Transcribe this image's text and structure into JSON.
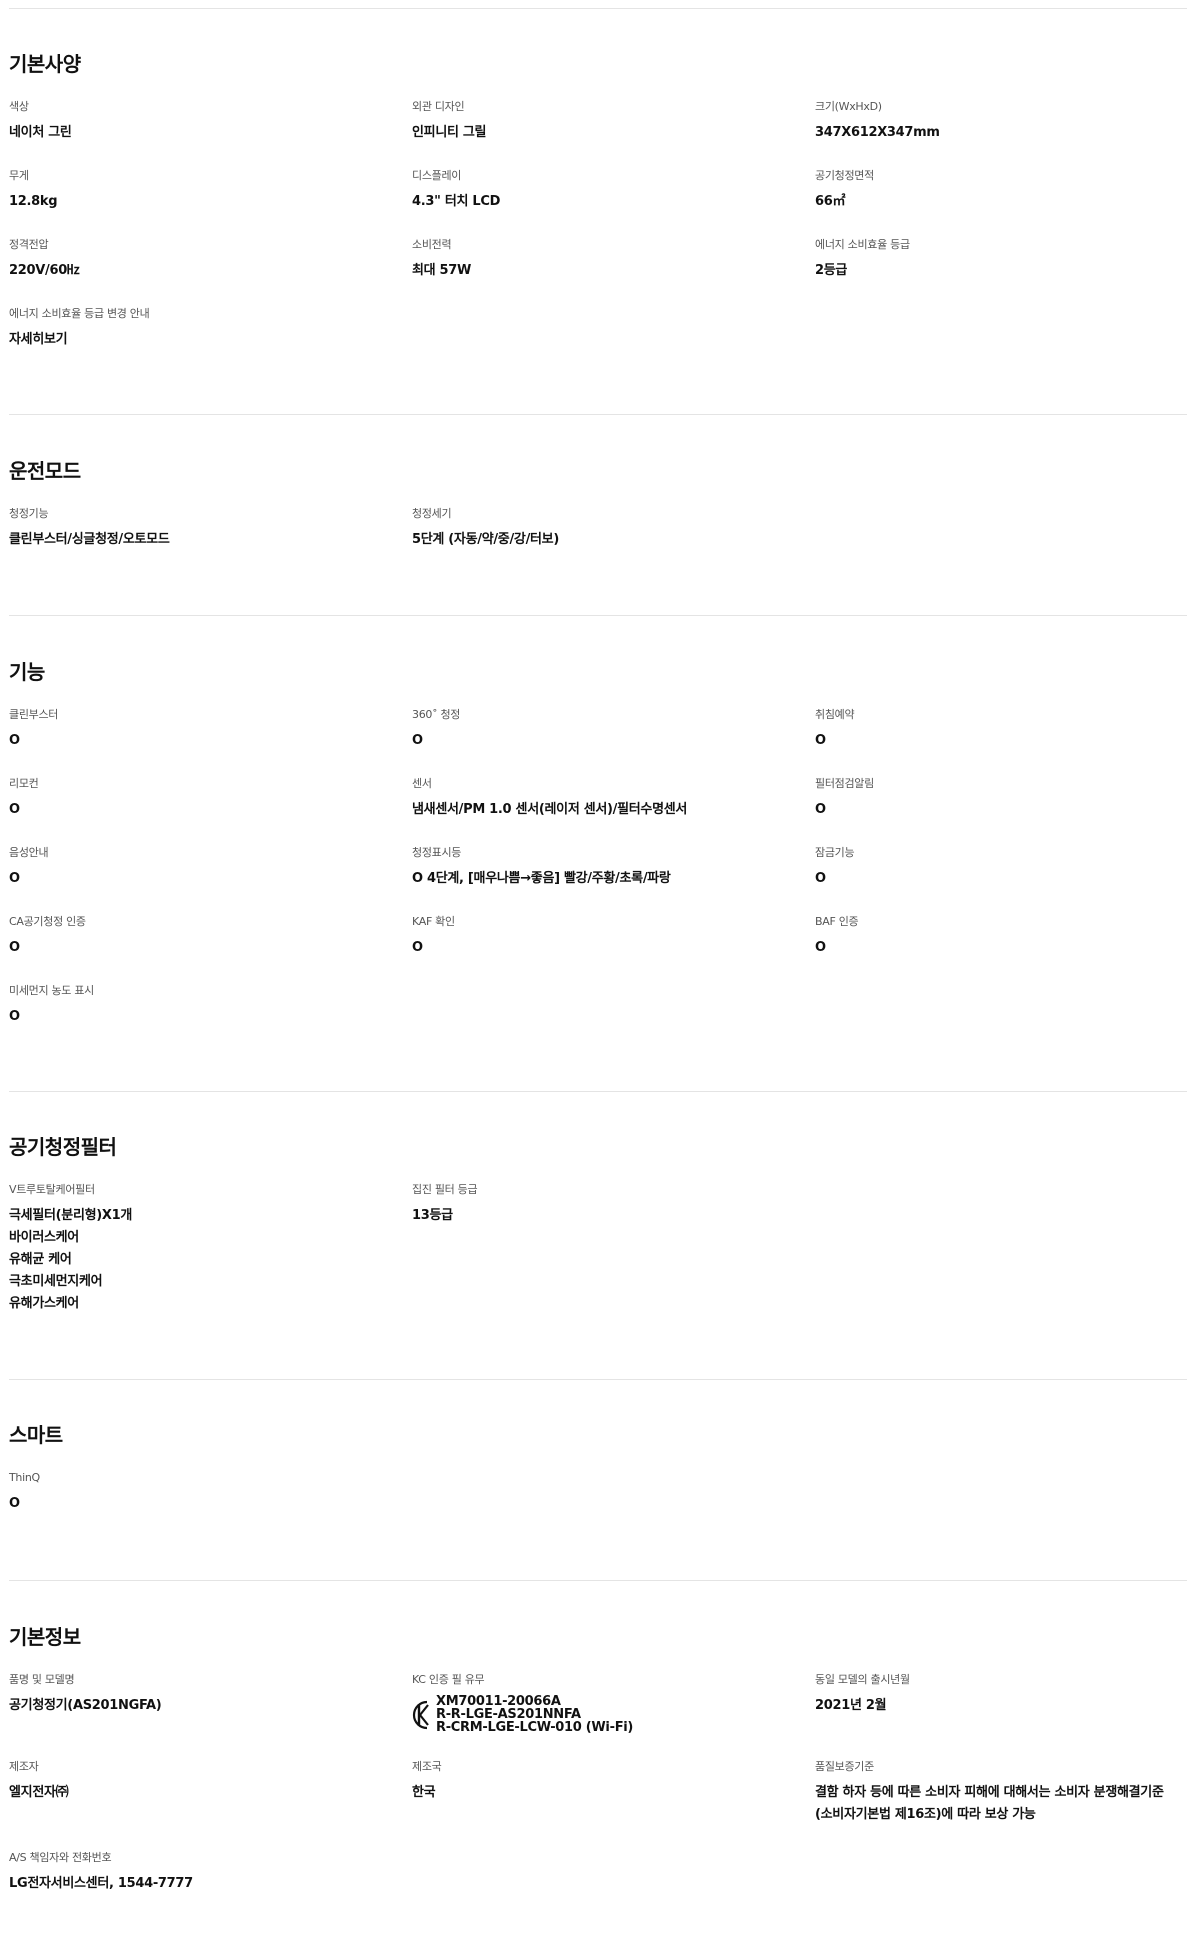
{
  "sections": [
    {
      "title": "기본사양",
      "specs": [
        {
          "label": "색상",
          "value": "네이처 그린"
        },
        {
          "label": "외관 디자인",
          "value": "인피니티 그릴"
        },
        {
          "label": "크기(WxHxD)",
          "value": "347X612X347mm"
        },
        {
          "label": "무게",
          "value": "12.8kg"
        },
        {
          "label": "디스플레이",
          "value": "4.3\" 터치 LCD"
        },
        {
          "label": "공기청정면적",
          "value": "66㎡"
        },
        {
          "label": "정격전압",
          "value": "220V/60㎐"
        },
        {
          "label": "소비전력",
          "value": "최대 57W"
        },
        {
          "label": "에너지 소비효율 등급",
          "value": "2등급"
        },
        {
          "label": "에너지 소비효율 등급 변경 안내",
          "value": "자세히보기"
        }
      ]
    },
    {
      "title": "운전모드",
      "specs": [
        {
          "label": "청정기능",
          "value": "클린부스터/싱글청정/오토모드"
        },
        {
          "label": "청정세기",
          "value": "5단계 (자동/약/중/강/터보)"
        }
      ]
    },
    {
      "title": "기능",
      "specs": [
        {
          "label": "클린부스터",
          "value": "O"
        },
        {
          "label": "360˚ 청정",
          "value": "O"
        },
        {
          "label": "취침예약",
          "value": "O"
        },
        {
          "label": "리모컨",
          "value": "O"
        },
        {
          "label": "센서",
          "value": "냄새센서/PM 1.0 센서(레이저 센서)/필터수명센서"
        },
        {
          "label": "필터점검알림",
          "value": "O"
        },
        {
          "label": "음성안내",
          "value": "O"
        },
        {
          "label": "청정표시등",
          "value": "O 4단계, [매우나쁨→좋음] 빨강/주황/초록/파랑"
        },
        {
          "label": "잠금기능",
          "value": "O"
        },
        {
          "label": "CA공기청정 인증",
          "value": "O"
        },
        {
          "label": "KAF 확인",
          "value": "O"
        },
        {
          "label": "BAF 인증",
          "value": "O"
        },
        {
          "label": "미세먼지 농도 표시",
          "value": "O"
        }
      ]
    },
    {
      "title": "공기청정필터",
      "specs": [
        {
          "label": "V트루토탈케어필터",
          "lines": [
            "극세필터(분리형)X1개",
            "바이러스케어",
            "유해균 케어",
            "극초미세먼지케어",
            "유해가스케어"
          ]
        },
        {
          "label": "집진 필터 등급",
          "value": "13등급"
        }
      ]
    },
    {
      "title": "스마트",
      "specs": [
        {
          "label": "ThinQ",
          "value": "O"
        }
      ]
    },
    {
      "title": "기본정보",
      "specs": [
        {
          "label": "품명 및 모델명",
          "value": "공기청정기(AS201NGFA)"
        },
        {
          "label": "KC 인증 필 유무",
          "kc_lines": [
            "XM70011-20066A",
            "R-R-LGE-AS201NNFA",
            "R-CRM-LGE-LCW-010 (Wi-Fi)"
          ]
        },
        {
          "label": "동일 모델의 출시년월",
          "value": "2021년 2월"
        },
        {
          "label": "제조자",
          "value": "엘지전자㈜"
        },
        {
          "label": "제조국",
          "value": "한국"
        },
        {
          "label": "품질보증기준",
          "value": "결함 하자 등에 따른 소비자 피해에 대해서는 소비자 분쟁해결기준 (소비자기본법 제16조)에 따라 보상 가능"
        },
        {
          "label": "A/S 책임자와 전화번호",
          "value": "LG전자서비스센터, 1544-7777"
        }
      ]
    }
  ]
}
